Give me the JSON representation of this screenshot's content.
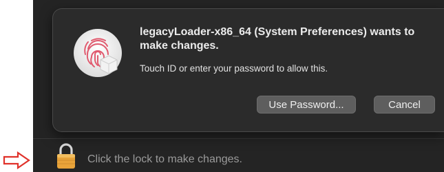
{
  "dialog": {
    "title": "legacyLoader-x86_64 (System Preferences) wants to make changes.",
    "message": "Touch ID or enter your password to allow this.",
    "buttons": {
      "use_password": "Use Password...",
      "cancel": "Cancel"
    },
    "icon": "touch-id-fingerprint-icon"
  },
  "footer": {
    "lock_text": "Click the lock to make changes.",
    "lock_icon": "lock-icon",
    "annotation_icon": "red-arrow-icon"
  },
  "colors": {
    "window_bg": "#242424",
    "dialog_bg": "#2b2b2b",
    "button_bg": "#5e5e5e",
    "fingerprint": "#e05a6e",
    "lock_gold": "#e8a33a",
    "arrow_red": "#e0312a"
  }
}
